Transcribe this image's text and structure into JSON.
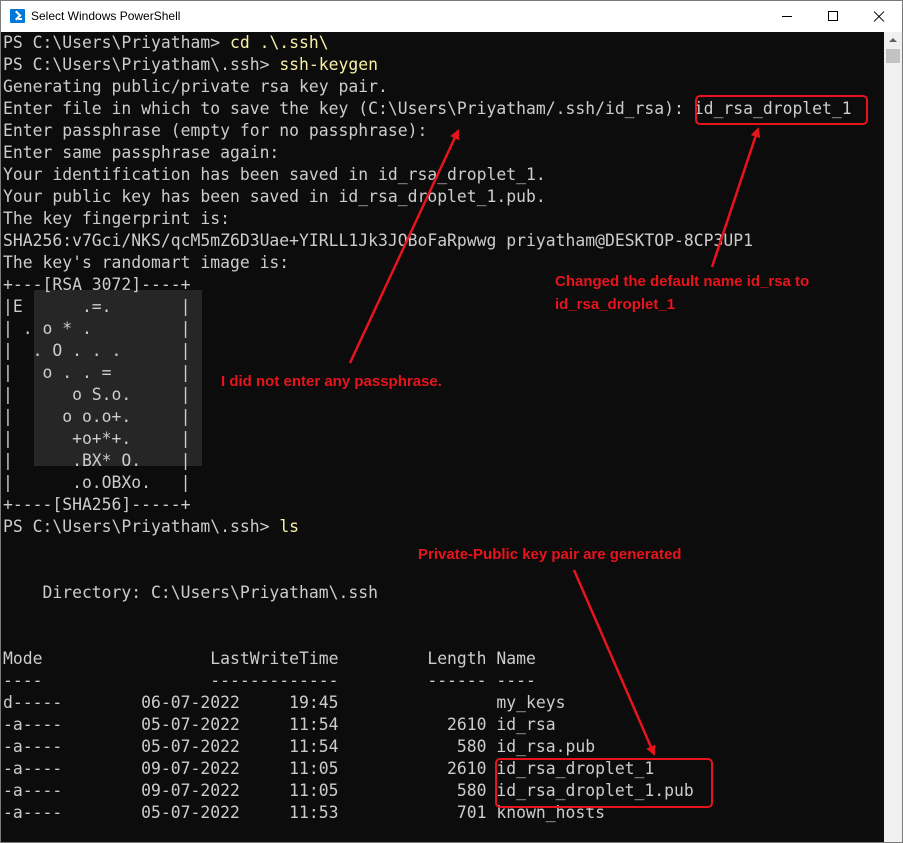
{
  "window": {
    "title": "Select Windows PowerShell",
    "minimize_label": "minimize",
    "maximize_label": "maximize",
    "close_label": "close"
  },
  "colors": {
    "console_bg": "#0c0c0c",
    "console_text": "#cccccc",
    "command_text": "#f9f1a5",
    "annotation": "#e8141c"
  },
  "console": {
    "l1_prompt": "PS C:\\Users\\Priyatham> ",
    "l1_cmd": "cd .\\.ssh\\",
    "l2_prompt": "PS C:\\Users\\Priyatham\\.ssh> ",
    "l2_cmd": "ssh-keygen",
    "l3": "Generating public/private rsa key pair.",
    "l4": "Enter file in which to save the key (C:\\Users\\Priyatham/.ssh/id_rsa): id_rsa_droplet_1",
    "l5": "Enter passphrase (empty for no passphrase):",
    "l6": "Enter same passphrase again:",
    "l7": "Your identification has been saved in id_rsa_droplet_1.",
    "l8": "Your public key has been saved in id_rsa_droplet_1.pub.",
    "l9": "The key fingerprint is:",
    "l10": "SHA256:v7Gci/NKS/qcM5mZ6D3Uae+YIRLL1Jk3JOBoFaRpwwg priyatham@DESKTOP-8CP3UP1",
    "l11": "The key's randomart image is:",
    "art": [
      "+---[RSA 3072]----+",
      "|E      .=.       |",
      "| . o * .         |",
      "|  . O . . .      |",
      "|   o . . =       |",
      "|      o S.o.     |",
      "|     o o.o+.     |",
      "|      +o+*+.     |",
      "|      .BX* O.    |",
      "|      .o.OBXo.   |",
      "+----[SHA256]-----+"
    ],
    "l23_prompt": "PS C:\\Users\\Priyatham\\.ssh> ",
    "l23_cmd": "ls",
    "dir_line": "    Directory: C:\\Users\\Priyatham\\.ssh",
    "header": "Mode                 LastWriteTime         Length Name",
    "underline": "----                 -------------         ------ ----",
    "rows": [
      "d-----        06-07-2022     19:45                my_keys",
      "-a----        05-07-2022     11:54           2610 id_rsa",
      "-a----        05-07-2022     11:54            580 id_rsa.pub",
      "-a----        09-07-2022     11:05           2610 id_rsa_droplet_1",
      "-a----        09-07-2022     11:05            580 id_rsa_droplet_1.pub",
      "-a----        05-07-2022     11:53            701 known_hosts"
    ]
  },
  "annotations": {
    "rename_note_1": "Changed the default name id_rsa to",
    "rename_note_2": "id_rsa_droplet_1",
    "passphrase_note": "I did not enter any passphrase.",
    "keypair_note": "Private-Public key pair are generated"
  }
}
